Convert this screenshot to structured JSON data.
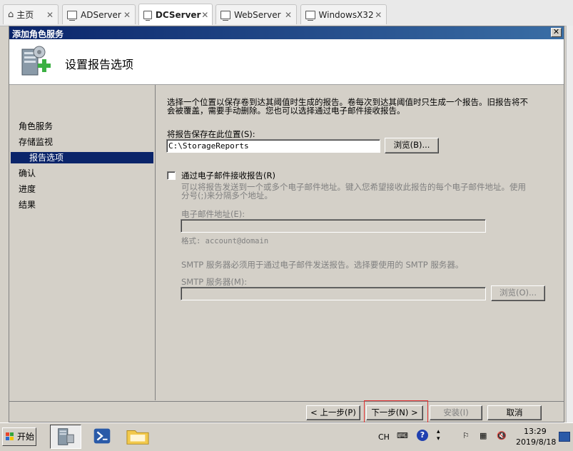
{
  "host_tabs": [
    {
      "label": "主页"
    },
    {
      "label": "ADServer"
    },
    {
      "label": "DCServer"
    },
    {
      "label": "WebServer"
    },
    {
      "label": "WindowsX32"
    }
  ],
  "window": {
    "title": "添加角色服务"
  },
  "header": {
    "title": "设置报告选项"
  },
  "nav": {
    "items": [
      {
        "label": "角色服务"
      },
      {
        "label": "存储监视"
      },
      {
        "label": "报告选项"
      },
      {
        "label": "确认"
      },
      {
        "label": "进度"
      },
      {
        "label": "结果"
      }
    ],
    "selected": "报告选项"
  },
  "content": {
    "description": "选择一个位置以保存卷到达其阈值时生成的报告。卷每次到达其阈值时只生成一个报告。旧报告将不\n会被覆盖，需要手动删除。您也可以选择通过电子邮件接收报告。",
    "save_location_label": "将报告保存在此位置(S):",
    "save_location_value": "C:\\StorageReports",
    "browse_label": "浏览(B)...",
    "email_checkbox_label": "通过电子邮件接收报告(R)",
    "email_help": "可以将报告发送到一个或多个电子邮件地址。键入您希望接收此报告的每个电子邮件地址。使用\n分号(;)来分隔多个地址。",
    "email_address_label": "电子邮件地址(E):",
    "email_address_value": "",
    "email_format_hint": "格式: account@domain",
    "smtp_help": "SMTP 服务器必须用于通过电子邮件发送报告。选择要使用的 SMTP 服务器。",
    "smtp_label": "SMTP 服务器(M):",
    "smtp_value": "",
    "smtp_browse_label": "浏览(O)..."
  },
  "footer": {
    "back_label": "< 上一步(P)",
    "next_label": "下一步(N) >",
    "install_label": "安装(I)",
    "cancel_label": "取消"
  },
  "taskbar": {
    "start_label": "开始",
    "ime": "CH",
    "time": "13:29",
    "date": "2019/8/18"
  }
}
